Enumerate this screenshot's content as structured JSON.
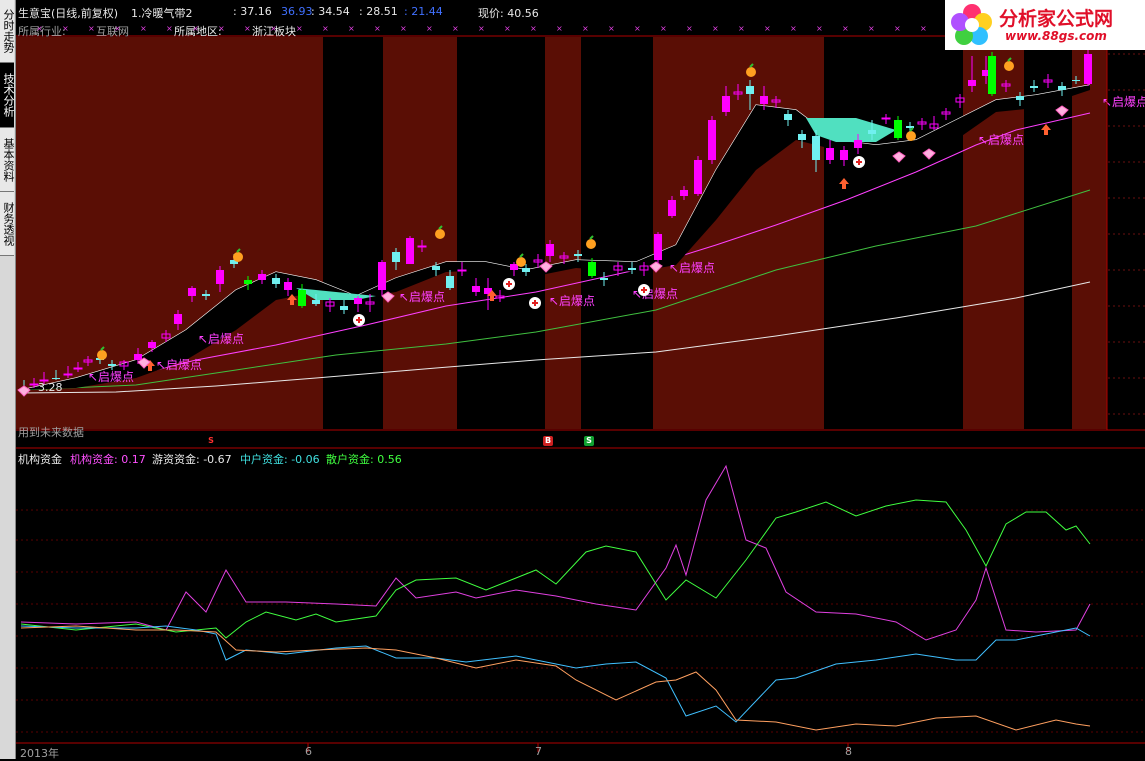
{
  "sidebar": {
    "tabs": [
      {
        "label": "分时走势",
        "active": false
      },
      {
        "label": "技术分析",
        "active": true
      },
      {
        "label": "基本资料",
        "active": false
      },
      {
        "label": "财务透视",
        "active": false
      }
    ]
  },
  "header": {
    "stock_name": "生意宝(日线,前复权)",
    "indicator": "1.冷暖气带2",
    "v1": ": 37.16",
    "v2": "36.93",
    "v3": ": 34.54",
    "v4": ": 28.51",
    "v5": ": 21.44",
    "price_label": "现价: 40.56",
    "industry_label": "所属行业:",
    "industry_value": "互联网",
    "region_label": "所属地区:",
    "region_value": "浙江板块"
  },
  "logo": {
    "name": "分析家公式网",
    "url": "www.88gs.com"
  },
  "price_chart": {
    "qibao_label": "启爆点",
    "low_label": "3.28",
    "no_data_text": "用到未来数据",
    "signal_s": "S",
    "signal_b": "B"
  },
  "lower_panel": {
    "title": "机构资金",
    "inst_label": "机构资金: 0.17",
    "hot_label": "游资资金: -0.67",
    "mid_label": "中户资金: -0.06",
    "retail_label": "散户资金: 0.56"
  },
  "xaxis": {
    "labels": [
      "2013年",
      "6",
      "7",
      "8"
    ]
  },
  "colors": {
    "bull": "#ff00ff",
    "bear_green": "#00ff00",
    "bear_cyan": "#70f0f0",
    "band": "#5a0e05",
    "inst": "#e040e0",
    "hot": "#40ff40",
    "mid": "#40c0ff",
    "retail": "#ffa060"
  }
}
